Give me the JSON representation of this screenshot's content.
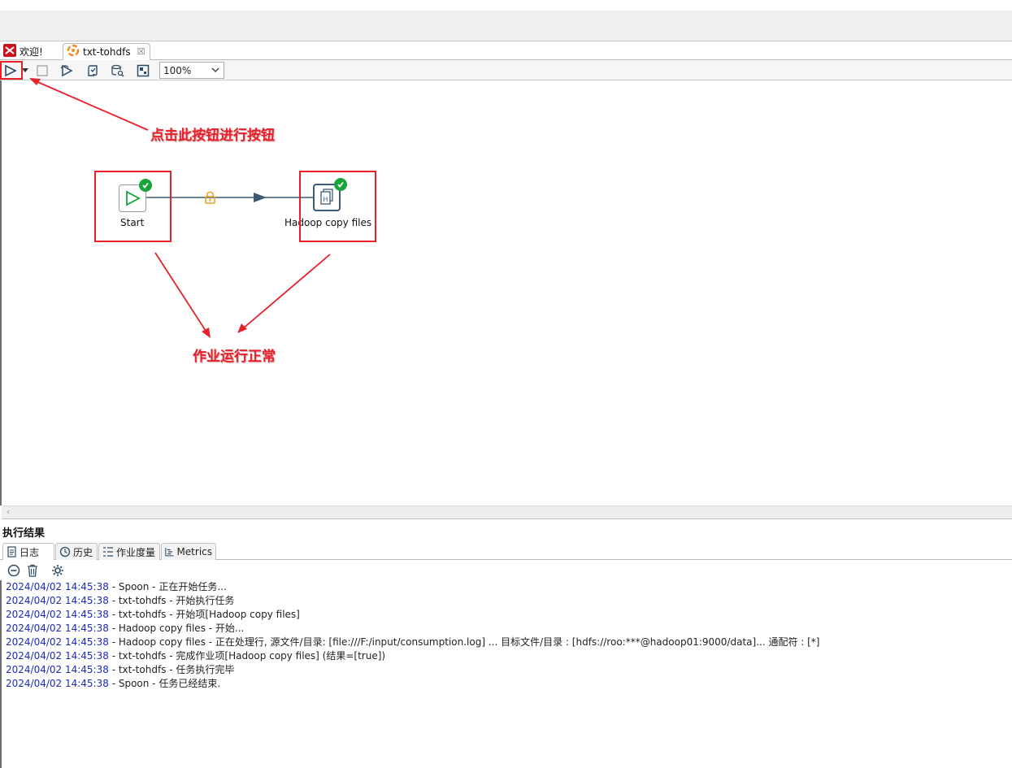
{
  "tabs": [
    {
      "label": "欢迎!",
      "icon": "spoon-icon"
    },
    {
      "label": "txt-tohdfs",
      "icon": "job-icon",
      "close": "☒"
    }
  ],
  "toolbar": {
    "buttons": [
      "run-icon",
      "run-dropdown-icon",
      "stop-icon",
      "replay-icon",
      "verify-icon",
      "sql-explore-icon",
      "layout-icon"
    ],
    "zoom": "100%"
  },
  "job": {
    "nodes": [
      {
        "label": "Start",
        "status": "success"
      },
      {
        "label": "Hadoop copy files",
        "status": "success"
      }
    ],
    "hop": {
      "type": "unconditional",
      "lock": "locked"
    }
  },
  "annotations": {
    "run_hint": "点击此按钮进行按钮",
    "ok_hint": "作业运行正常"
  },
  "results": {
    "title": "执行结果",
    "tabs": [
      "日志",
      "历史",
      "作业度量",
      "Metrics"
    ],
    "log": [
      {
        "ts": "2024/04/02 14:45:38",
        "msg": " - Spoon - 正在开始任务..."
      },
      {
        "ts": "2024/04/02 14:45:38",
        "msg": " - txt-tohdfs - 开始执行任务"
      },
      {
        "ts": "2024/04/02 14:45:38",
        "msg": " - txt-tohdfs - 开始项[Hadoop copy files]"
      },
      {
        "ts": "2024/04/02 14:45:38",
        "msg": " - Hadoop copy files - 开始..."
      },
      {
        "ts": "2024/04/02 14:45:38",
        "msg": " - Hadoop copy files - 正在处理行, 源文件/目录: [file:///F:/input/consumption.log] ... 目标文件/目录 : [hdfs://roo:***@hadoop01:9000/data]... 通配符 : [*]"
      },
      {
        "ts": "2024/04/02 14:45:38",
        "msg": " - txt-tohdfs - 完成作业项[Hadoop copy files] (结果=[true])"
      },
      {
        "ts": "2024/04/02 14:45:38",
        "msg": " - txt-tohdfs - 任务执行完毕"
      },
      {
        "ts": "2024/04/02 14:45:38",
        "msg": " - Spoon - 任务已经结束."
      }
    ]
  },
  "colors": {
    "annotation": "#e8202a",
    "timestamp": "#1c2bb8",
    "success": "#1aa33c",
    "hop": "#3d5a74",
    "lock": "#f0a020"
  }
}
